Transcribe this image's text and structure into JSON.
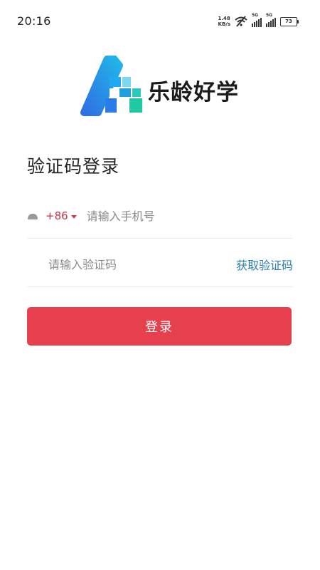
{
  "status_bar": {
    "time": "20:16",
    "net_speed_value": "1.48",
    "net_speed_unit": "KB/s",
    "sim1_label": "5G",
    "sim2_label": "5G",
    "battery_level": "73"
  },
  "brand": {
    "name": "乐龄好学",
    "logo_icon": "letter-a-logo-icon",
    "logo_colors": [
      "#2f6fe4",
      "#21b8e8",
      "#1fc7a3"
    ]
  },
  "page": {
    "title": "验证码登录"
  },
  "phone": {
    "country_code": "+86",
    "placeholder": "请输入手机号",
    "value": ""
  },
  "code": {
    "placeholder": "请输入验证码",
    "value": "",
    "get_code_label": "获取验证码"
  },
  "login": {
    "label": "登录",
    "color": "#e6404e"
  }
}
